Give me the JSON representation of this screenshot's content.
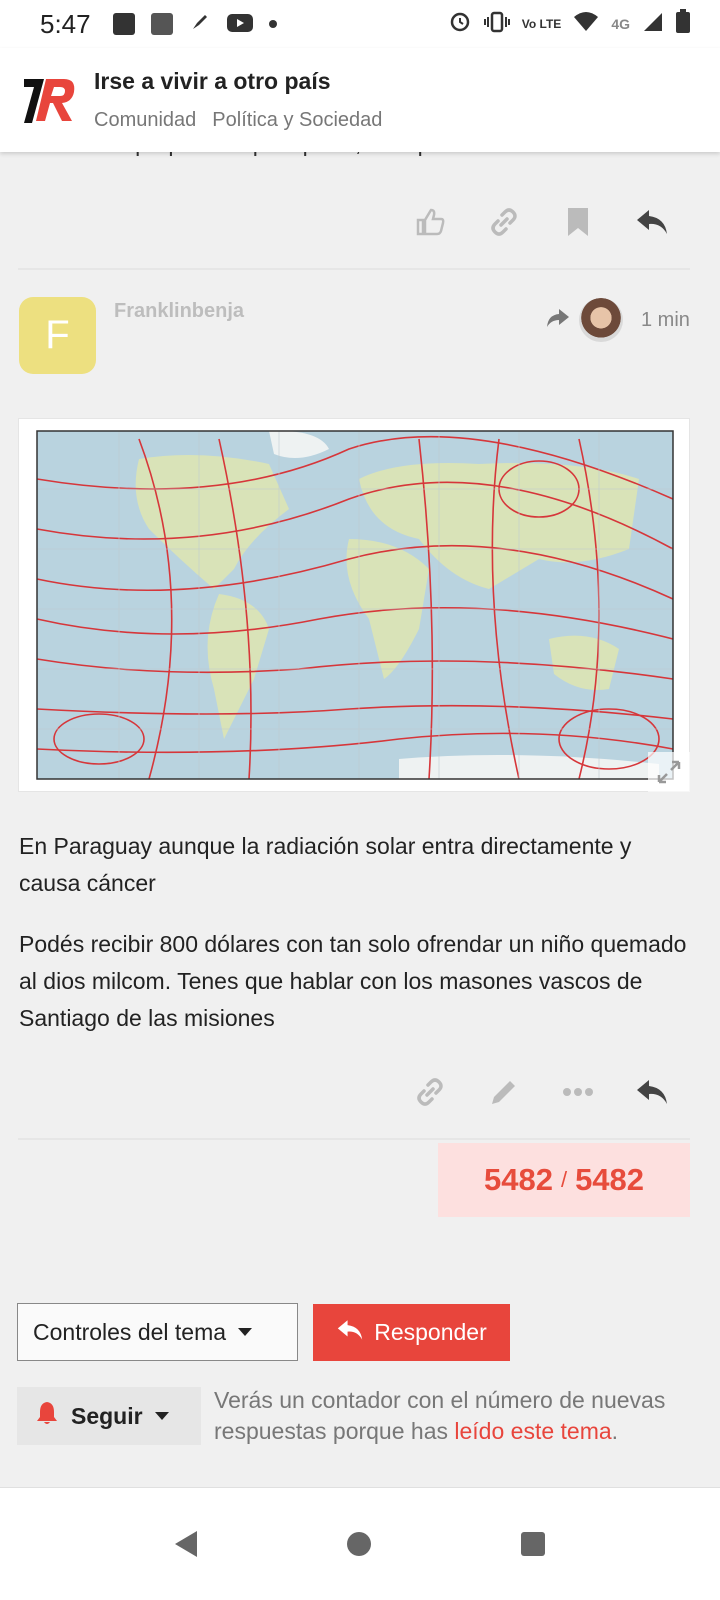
{
  "status_bar": {
    "time": "5:47",
    "network_labels": [
      "Vo LTE",
      "4G"
    ]
  },
  "header": {
    "topic_title": "Irse a vivir a otro país",
    "categories": [
      "Comunidad",
      "Política y Sociedad"
    ]
  },
  "previous_post": {
    "cut_text": "es hora de preparar el pasaporte, este país no tiene futuro"
  },
  "post": {
    "avatar_letter": "F",
    "username": "Franklinbenja",
    "time_ago": "1 min",
    "paragraph1": "En Paraguay aunque la radiación solar entra directamente y causa cáncer",
    "paragraph2": "Podés recibir 800 dólares con tan solo ofrendar un niño quemado al dios milcom. Tenes que hablar con los masones vascos de Santiago de las misiones"
  },
  "progress": {
    "current": "5482",
    "separator": "/",
    "total": "5482"
  },
  "footer": {
    "controls_label": "Controles del tema",
    "reply_label": "Responder",
    "follow_label": "Seguir",
    "note_text": "Verás un contador con el número de nuevas respuestas porque has ",
    "note_link": "leído este tema",
    "note_end": "."
  },
  "colors": {
    "accent": "#e8453c",
    "avatar_bg": "#ede080",
    "progress_bg": "#fde0df"
  }
}
